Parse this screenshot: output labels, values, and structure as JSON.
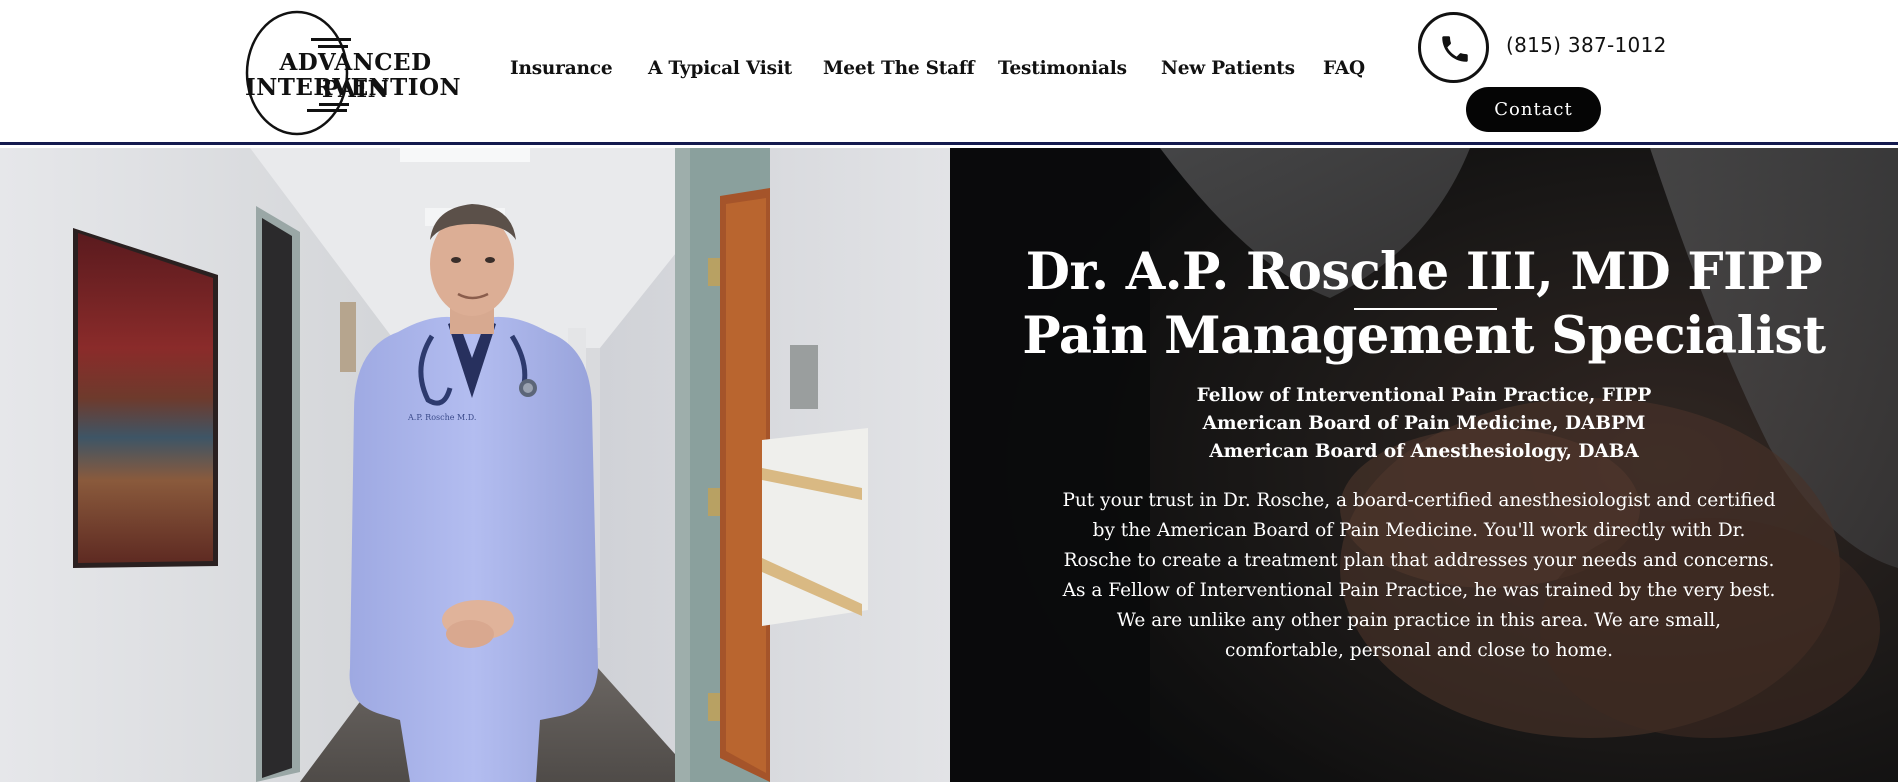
{
  "logo": {
    "line1": "ADVANCED PAIN",
    "line2": "INTERVENTION"
  },
  "nav": {
    "items": [
      {
        "label": "Insurance"
      },
      {
        "label": "A Typical Visit"
      },
      {
        "label": "Meet The Staff"
      },
      {
        "label": "Testimonials"
      },
      {
        "label": "New Patients"
      },
      {
        "label": "FAQ"
      }
    ]
  },
  "header": {
    "phone": "(815) 387-1012",
    "contact_label": "Contact",
    "phone_icon": "phone-icon"
  },
  "hero": {
    "title_line1": "Dr. A.P. Rosche III, MD FIPP",
    "title_line2": "Pain Management Specialist",
    "credentials": [
      "Fellow of Interventional Pain Practice, FIPP",
      "American Board of Pain Medicine, DABPM",
      "American Board of Anesthesiology, DABA"
    ],
    "paragraph": "Put your trust in Dr. Rosche, a board-certified anesthesiologist and certified by the American Board of Pain Medicine. You'll work directly with Dr. Rosche to create a treatment plan that addresses your needs and concerns. As a Fellow of Interventional Pain Practice, he was trained by the very best. We are unlike any other pain practice in this area. We are small, comfortable, personal and close to home.",
    "photo_coat_text": "A.P. Rosche M.D."
  },
  "colors": {
    "header_border": "#141a4e",
    "contact_button": "#050505",
    "hero_overlay": "#1c1a1a",
    "coat": "#a9b4ea"
  }
}
